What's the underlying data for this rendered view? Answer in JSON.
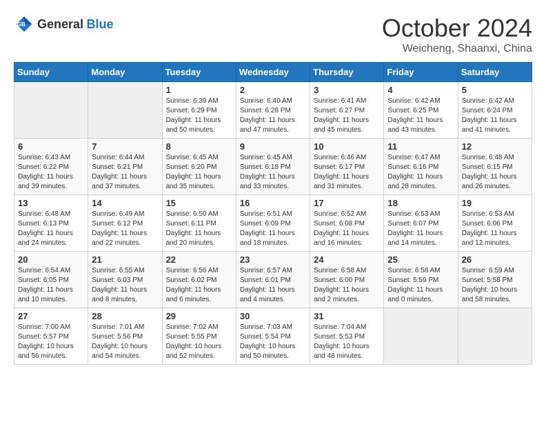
{
  "header": {
    "logo": {
      "general": "General",
      "blue": "Blue"
    },
    "title": "October 2024",
    "location": "Weicheng, Shaanxi, China"
  },
  "weekdays": [
    "Sunday",
    "Monday",
    "Tuesday",
    "Wednesday",
    "Thursday",
    "Friday",
    "Saturday"
  ],
  "weeks": [
    [
      {
        "day": "",
        "empty": true
      },
      {
        "day": "",
        "empty": true
      },
      {
        "day": "1",
        "sunrise": "Sunrise: 6:39 AM",
        "sunset": "Sunset: 6:29 PM",
        "daylight": "Daylight: 11 hours and 50 minutes."
      },
      {
        "day": "2",
        "sunrise": "Sunrise: 6:40 AM",
        "sunset": "Sunset: 6:28 PM",
        "daylight": "Daylight: 11 hours and 47 minutes."
      },
      {
        "day": "3",
        "sunrise": "Sunrise: 6:41 AM",
        "sunset": "Sunset: 6:27 PM",
        "daylight": "Daylight: 11 hours and 45 minutes."
      },
      {
        "day": "4",
        "sunrise": "Sunrise: 6:42 AM",
        "sunset": "Sunset: 6:25 PM",
        "daylight": "Daylight: 11 hours and 43 minutes."
      },
      {
        "day": "5",
        "sunrise": "Sunrise: 6:42 AM",
        "sunset": "Sunset: 6:24 PM",
        "daylight": "Daylight: 11 hours and 41 minutes."
      }
    ],
    [
      {
        "day": "6",
        "sunrise": "Sunrise: 6:43 AM",
        "sunset": "Sunset: 6:22 PM",
        "daylight": "Daylight: 11 hours and 39 minutes."
      },
      {
        "day": "7",
        "sunrise": "Sunrise: 6:44 AM",
        "sunset": "Sunset: 6:21 PM",
        "daylight": "Daylight: 11 hours and 37 minutes."
      },
      {
        "day": "8",
        "sunrise": "Sunrise: 6:45 AM",
        "sunset": "Sunset: 6:20 PM",
        "daylight": "Daylight: 11 hours and 35 minutes."
      },
      {
        "day": "9",
        "sunrise": "Sunrise: 6:45 AM",
        "sunset": "Sunset: 6:18 PM",
        "daylight": "Daylight: 11 hours and 33 minutes."
      },
      {
        "day": "10",
        "sunrise": "Sunrise: 6:46 AM",
        "sunset": "Sunset: 6:17 PM",
        "daylight": "Daylight: 11 hours and 31 minutes."
      },
      {
        "day": "11",
        "sunrise": "Sunrise: 6:47 AM",
        "sunset": "Sunset: 6:16 PM",
        "daylight": "Daylight: 11 hours and 28 minutes."
      },
      {
        "day": "12",
        "sunrise": "Sunrise: 6:48 AM",
        "sunset": "Sunset: 6:15 PM",
        "daylight": "Daylight: 11 hours and 26 minutes."
      }
    ],
    [
      {
        "day": "13",
        "sunrise": "Sunrise: 6:48 AM",
        "sunset": "Sunset: 6:13 PM",
        "daylight": "Daylight: 11 hours and 24 minutes."
      },
      {
        "day": "14",
        "sunrise": "Sunrise: 6:49 AM",
        "sunset": "Sunset: 6:12 PM",
        "daylight": "Daylight: 11 hours and 22 minutes."
      },
      {
        "day": "15",
        "sunrise": "Sunrise: 6:50 AM",
        "sunset": "Sunset: 6:11 PM",
        "daylight": "Daylight: 11 hours and 20 minutes."
      },
      {
        "day": "16",
        "sunrise": "Sunrise: 6:51 AM",
        "sunset": "Sunset: 6:09 PM",
        "daylight": "Daylight: 11 hours and 18 minutes."
      },
      {
        "day": "17",
        "sunrise": "Sunrise: 6:52 AM",
        "sunset": "Sunset: 6:08 PM",
        "daylight": "Daylight: 11 hours and 16 minutes."
      },
      {
        "day": "18",
        "sunrise": "Sunrise: 6:53 AM",
        "sunset": "Sunset: 6:07 PM",
        "daylight": "Daylight: 11 hours and 14 minutes."
      },
      {
        "day": "19",
        "sunrise": "Sunrise: 6:53 AM",
        "sunset": "Sunset: 6:06 PM",
        "daylight": "Daylight: 11 hours and 12 minutes."
      }
    ],
    [
      {
        "day": "20",
        "sunrise": "Sunrise: 6:54 AM",
        "sunset": "Sunset: 6:05 PM",
        "daylight": "Daylight: 11 hours and 10 minutes."
      },
      {
        "day": "21",
        "sunrise": "Sunrise: 6:55 AM",
        "sunset": "Sunset: 6:03 PM",
        "daylight": "Daylight: 11 hours and 8 minutes."
      },
      {
        "day": "22",
        "sunrise": "Sunrise: 6:56 AM",
        "sunset": "Sunset: 6:02 PM",
        "daylight": "Daylight: 11 hours and 6 minutes."
      },
      {
        "day": "23",
        "sunrise": "Sunrise: 6:57 AM",
        "sunset": "Sunset: 6:01 PM",
        "daylight": "Daylight: 11 hours and 4 minutes."
      },
      {
        "day": "24",
        "sunrise": "Sunrise: 6:58 AM",
        "sunset": "Sunset: 6:00 PM",
        "daylight": "Daylight: 11 hours and 2 minutes."
      },
      {
        "day": "25",
        "sunrise": "Sunrise: 6:58 AM",
        "sunset": "Sunset: 5:59 PM",
        "daylight": "Daylight: 11 hours and 0 minutes."
      },
      {
        "day": "26",
        "sunrise": "Sunrise: 6:59 AM",
        "sunset": "Sunset: 5:58 PM",
        "daylight": "Daylight: 10 hours and 58 minutes."
      }
    ],
    [
      {
        "day": "27",
        "sunrise": "Sunrise: 7:00 AM",
        "sunset": "Sunset: 5:57 PM",
        "daylight": "Daylight: 10 hours and 56 minutes."
      },
      {
        "day": "28",
        "sunrise": "Sunrise: 7:01 AM",
        "sunset": "Sunset: 5:56 PM",
        "daylight": "Daylight: 10 hours and 54 minutes."
      },
      {
        "day": "29",
        "sunrise": "Sunrise: 7:02 AM",
        "sunset": "Sunset: 5:55 PM",
        "daylight": "Daylight: 10 hours and 52 minutes."
      },
      {
        "day": "30",
        "sunrise": "Sunrise: 7:03 AM",
        "sunset": "Sunset: 5:54 PM",
        "daylight": "Daylight: 10 hours and 50 minutes."
      },
      {
        "day": "31",
        "sunrise": "Sunrise: 7:04 AM",
        "sunset": "Sunset: 5:53 PM",
        "daylight": "Daylight: 10 hours and 48 minutes."
      },
      {
        "day": "",
        "empty": true
      },
      {
        "day": "",
        "empty": true
      }
    ]
  ]
}
